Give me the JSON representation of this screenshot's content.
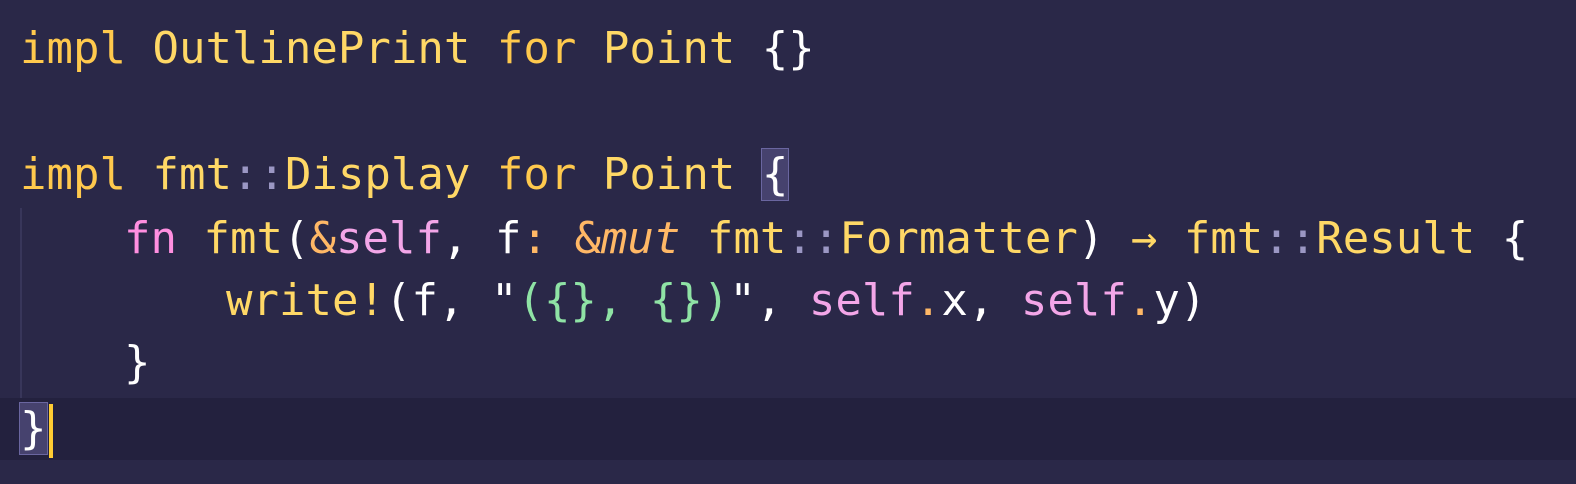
{
  "editor": {
    "language": "rust",
    "lines": {
      "l1": {
        "impl": "impl",
        "trait": "OutlinePrint",
        "for": "for",
        "type": "Point",
        "body": "{}"
      },
      "l2": {
        "impl": "impl",
        "path": "fmt",
        "sep": "::",
        "trait": "Display",
        "for": "for",
        "type": "Point",
        "open": "{"
      },
      "l3": {
        "fn": "fn",
        "name": "fmt",
        "lparen": "(",
        "amp": "&",
        "self": "self",
        "comma1": ",",
        "param": "f",
        "colon": ":",
        "amp2": "&",
        "mut": "mut",
        "path1": "fmt",
        "sep1": "::",
        "type1": "Formatter",
        "rparen": ")",
        "arrow": "→",
        "path2": "fmt",
        "sep2": "::",
        "type2": "Result",
        "open": "{"
      },
      "l4": {
        "macro": "write!",
        "lparen": "(",
        "arg": "f",
        "comma1": ",",
        "quote1": "\"",
        "str": "({}, {})",
        "quote2": "\"",
        "comma2": ",",
        "self1": "self",
        "dot1": ".",
        "field1": "x",
        "comma3": ",",
        "self2": "self",
        "dot2": ".",
        "field2": "y",
        "rparen": ")"
      },
      "l5": {
        "close": "}"
      },
      "l6": {
        "close": "}"
      }
    },
    "colors": {
      "background": "#2a2848",
      "keyword": "#ffc94d",
      "fn_keyword": "#ff8fe0",
      "self": "#f3a6e8",
      "string": "#8fe3a5",
      "cursor": "#ffcc33"
    }
  }
}
